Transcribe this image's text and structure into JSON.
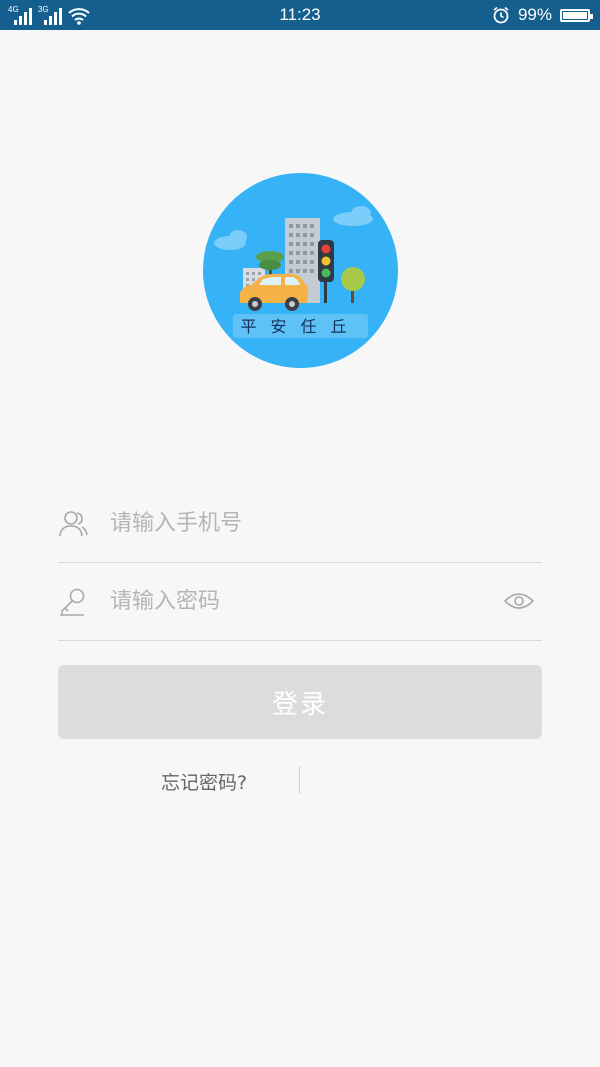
{
  "status_bar": {
    "network_1": "4G",
    "network_2": "3G",
    "time": "11:23",
    "battery_text": "99%",
    "battery_level": 0.99,
    "icons": [
      "signal-4g-icon",
      "signal-3g-icon",
      "wifi-icon",
      "alarm-icon",
      "battery-icon"
    ]
  },
  "logo": {
    "text": "平安任丘",
    "colors": {
      "circle": "#36b2f6",
      "car": "#f5b347",
      "building": "#b8bec6"
    }
  },
  "form": {
    "phone_placeholder": "请输入手机号",
    "password_placeholder": "请输入密码",
    "login_label": "登录",
    "forgot_label": "忘记密码?",
    "icons": [
      "user-icon",
      "key-icon",
      "eye-icon"
    ]
  },
  "colors": {
    "status_bar": "#155f8e",
    "background": "#f7f7f7",
    "button_disabled": "#dcdcdc",
    "placeholder": "#b5b5b5"
  }
}
